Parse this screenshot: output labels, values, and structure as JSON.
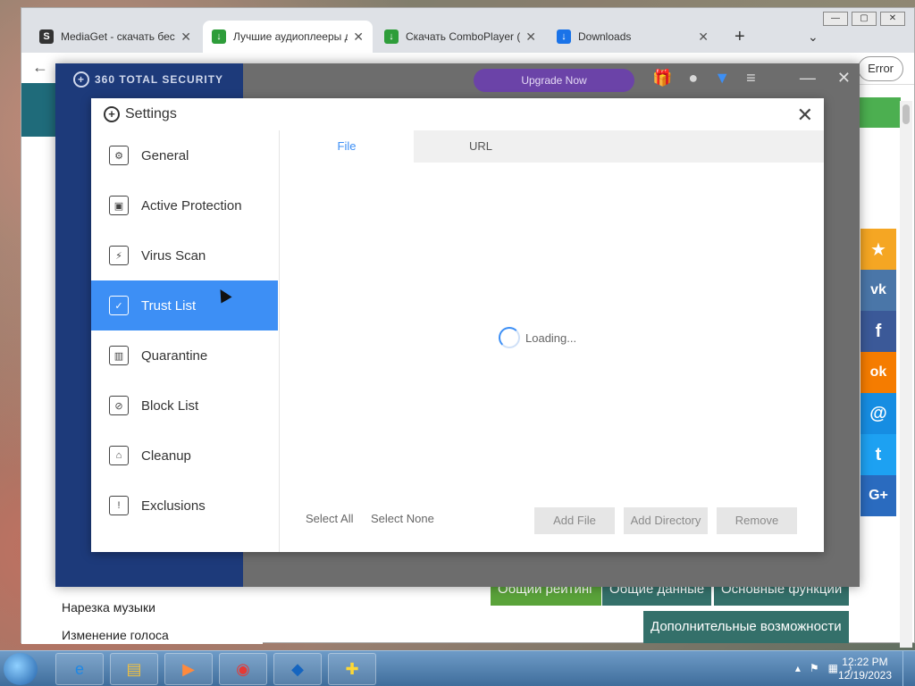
{
  "browser": {
    "tabs": [
      {
        "label": "MediaGet - скачать бес",
        "fav": "S",
        "fav_color": "#333333"
      },
      {
        "label": "Лучшие аудиоплееры д",
        "fav": "↓",
        "fav_color": "#2e9d3a"
      },
      {
        "label": "Скачать ComboPlayer (",
        "fav": "↓",
        "fav_color": "#2e9d3a"
      },
      {
        "label": "Downloads",
        "fav": "↓",
        "fav_color": "#1a73e8"
      }
    ],
    "new_tab": "+",
    "error_label": "Error"
  },
  "page": {
    "links": [
      "Нарезка музыки",
      "Изменение голоса"
    ],
    "rating_buttons": [
      {
        "label": "Общий рейтинг",
        "color": "#5aa33a"
      },
      {
        "label": "Общие данные",
        "color": "#34706a"
      },
      {
        "label": "Основные функции",
        "color": "#34706a"
      },
      {
        "label": "Дополнительные возможности",
        "color": "#34706a"
      }
    ],
    "social": [
      {
        "icon": "star-icon",
        "glyph": "★",
        "color": "#f5a623"
      },
      {
        "icon": "vk-icon",
        "glyph": "vk",
        "color": "#4a76a8"
      },
      {
        "icon": "facebook-icon",
        "glyph": "f",
        "color": "#3b5998"
      },
      {
        "icon": "odnoklassniki-icon",
        "glyph": "ok",
        "color": "#f57c00"
      },
      {
        "icon": "mail-icon",
        "glyph": "@",
        "color": "#168de2"
      },
      {
        "icon": "twitter-icon",
        "glyph": "t",
        "color": "#1da1f2"
      },
      {
        "icon": "googleplus-icon",
        "glyph": "G+",
        "color": "#2a6bbf"
      }
    ]
  },
  "app": {
    "logo": "360 TOTAL SECURITY",
    "upgrade_label": "Upgrade Now"
  },
  "settings": {
    "title": "Settings",
    "nav": [
      {
        "label": "General",
        "icon": "gear-icon",
        "glyph": "⚙"
      },
      {
        "label": "Active Protection",
        "icon": "shield-icon",
        "glyph": "▣"
      },
      {
        "label": "Virus Scan",
        "icon": "scan-icon",
        "glyph": "⚡"
      },
      {
        "label": "Trust List",
        "icon": "trust-list-icon",
        "glyph": "✓"
      },
      {
        "label": "Quarantine",
        "icon": "quarantine-icon",
        "glyph": "▥"
      },
      {
        "label": "Block List",
        "icon": "block-list-icon",
        "glyph": "⊘"
      },
      {
        "label": "Cleanup",
        "icon": "cleanup-icon",
        "glyph": "⌂"
      },
      {
        "label": "Exclusions",
        "icon": "exclusions-icon",
        "glyph": "!"
      }
    ],
    "active_nav": "Trust List",
    "tabs": [
      "File",
      "URL"
    ],
    "active_tab": "File",
    "loading_text": "Loading...",
    "select_all": "Select All",
    "select_none": "Select None",
    "add_file": "Add File",
    "add_directory": "Add Directory",
    "remove": "Remove"
  },
  "taskbar": {
    "time": "12:22 PM",
    "date": "12/19/2023"
  }
}
